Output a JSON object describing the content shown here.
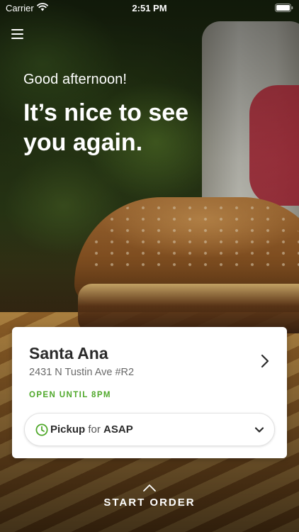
{
  "status_bar": {
    "carrier": "Carrier",
    "time": "2:51 PM",
    "icons": [
      "wifi-icon",
      "battery-icon"
    ]
  },
  "menu": {
    "icon": "hamburger-menu-icon"
  },
  "greeting": {
    "subtitle": "Good afternoon!",
    "headline_line1": "It’s nice to see",
    "headline_line2": "you again."
  },
  "store": {
    "name": "Santa Ana",
    "address": "2431 N Tustin Ave #R2",
    "hours": "OPEN UNTIL 8PM",
    "order": {
      "mode": "Pickup",
      "connector": "for",
      "time": "ASAP",
      "icon": "clock-icon"
    }
  },
  "cta": {
    "label": "START ORDER",
    "icon": "chevron-up-icon"
  },
  "colors": {
    "accent_green": "#4fa82a",
    "card_background": "#ffffff",
    "title_text": "#2b2b2b"
  }
}
